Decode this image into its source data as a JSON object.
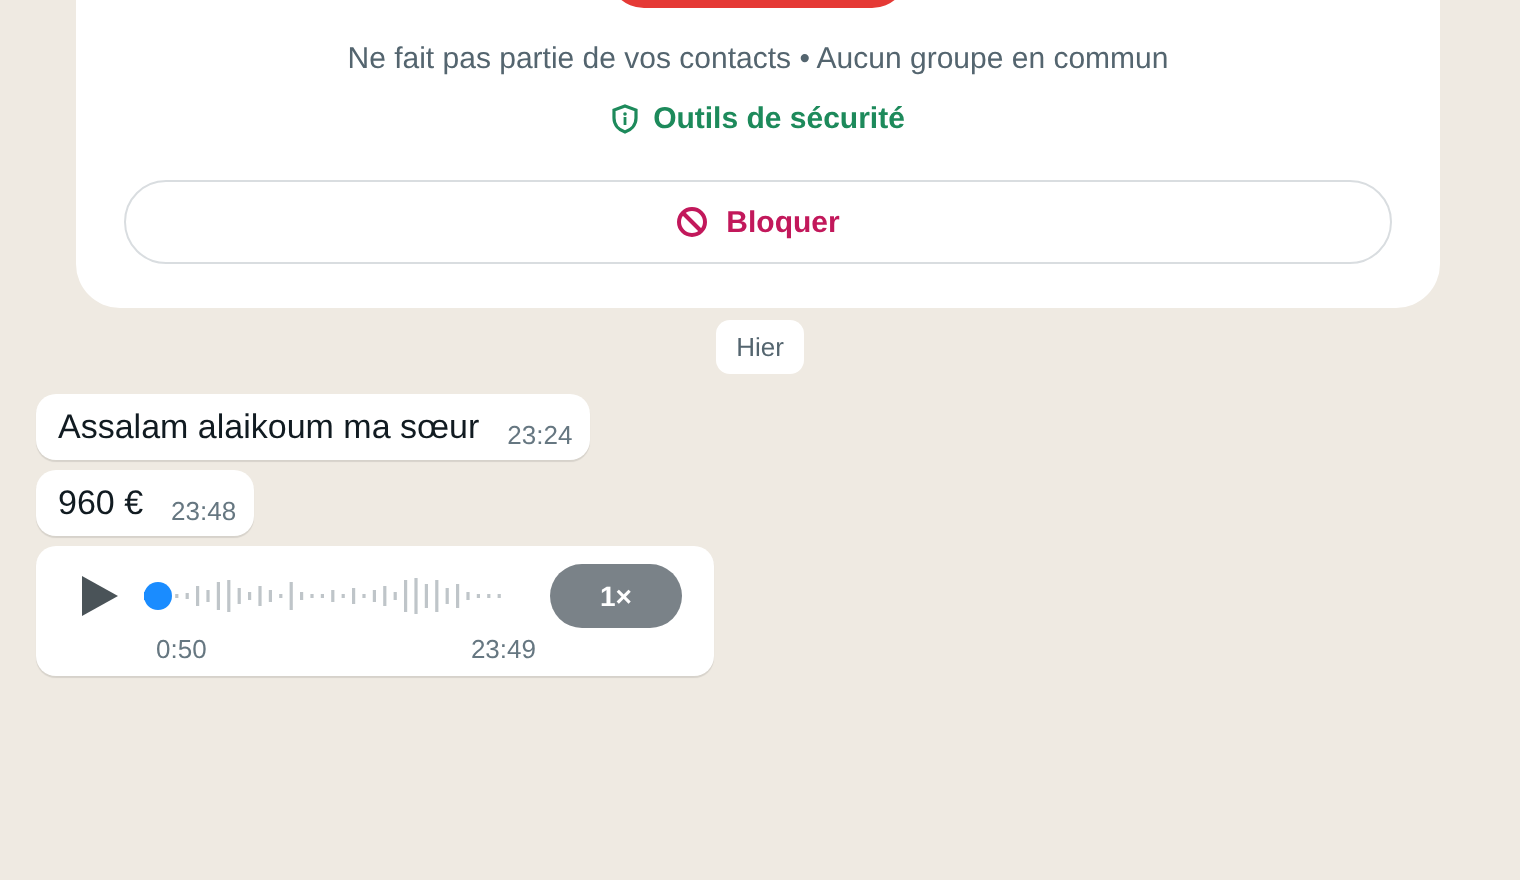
{
  "contact_card": {
    "info": "Ne fait pas partie de vos contacts • Aucun groupe en commun",
    "safety_link": "Outils de sécurité",
    "block_button": "Bloquer"
  },
  "date_chip": "Hier",
  "messages": [
    {
      "kind": "text",
      "text": "Assalam alaikoum ma sœur",
      "time": "23:24"
    },
    {
      "kind": "text",
      "text": "960 €",
      "time": "23:48"
    },
    {
      "kind": "voice",
      "duration": "0:50",
      "time": "23:49",
      "speed": "1×"
    }
  ]
}
